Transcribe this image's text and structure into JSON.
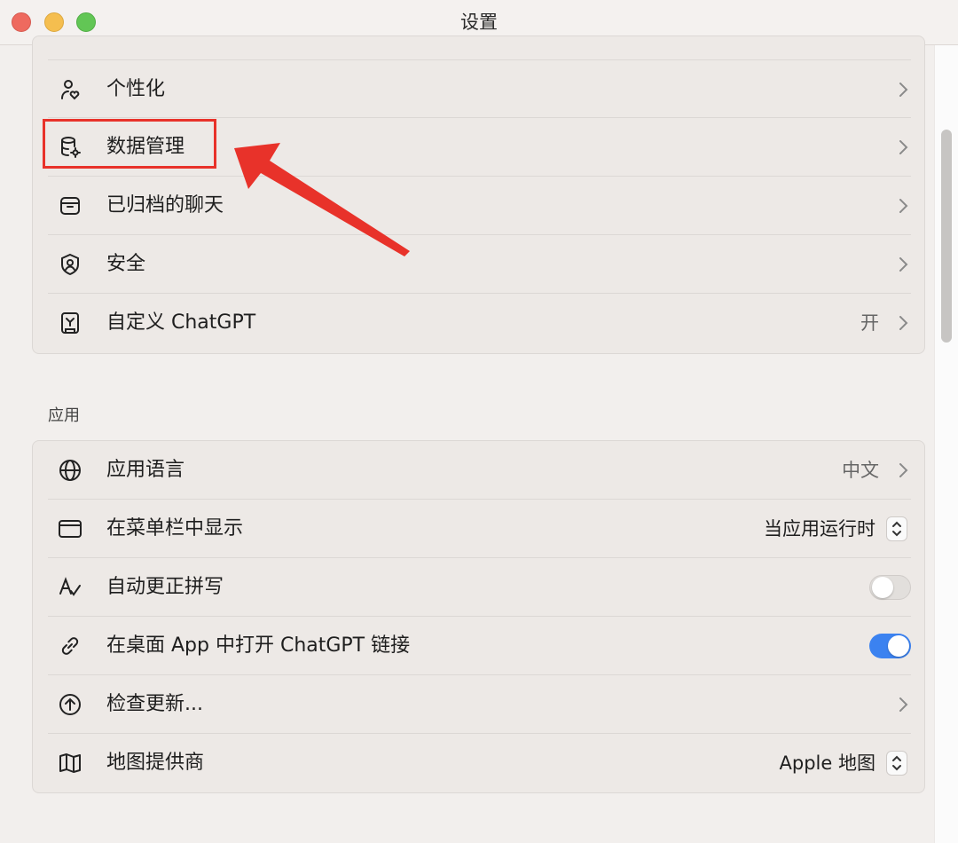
{
  "window": {
    "title": "设置"
  },
  "account_group": {
    "items": [
      {
        "label": "个性化",
        "icon": "person-heart-icon",
        "value": ""
      },
      {
        "label": "数据管理",
        "icon": "database-gear-icon",
        "value": ""
      },
      {
        "label": "已归档的聊天",
        "icon": "archive-icon",
        "value": ""
      },
      {
        "label": "安全",
        "icon": "shield-icon",
        "value": ""
      },
      {
        "label": "自定义 ChatGPT",
        "icon": "custom-gpt-icon",
        "value": "开"
      }
    ]
  },
  "app_section": {
    "header": "应用",
    "items": [
      {
        "label": "应用语言",
        "icon": "globe-icon",
        "value": "中文",
        "control": "chevron"
      },
      {
        "label": "在菜单栏中显示",
        "icon": "window-icon",
        "value": "当应用运行时",
        "control": "popup"
      },
      {
        "label": "自动更正拼写",
        "icon": "spellcheck-icon",
        "control": "toggle",
        "on": false
      },
      {
        "label": "在桌面 App 中打开 ChatGPT 链接",
        "icon": "link-icon",
        "control": "toggle",
        "on": true
      },
      {
        "label": "检查更新...",
        "icon": "upload-circle-icon",
        "value": "",
        "control": "chevron"
      },
      {
        "label": "地图提供商",
        "icon": "map-icon",
        "value": "Apple 地图",
        "control": "popup"
      }
    ]
  },
  "colors": {
    "accent": "#3b82f0",
    "annotation": "#e8322a",
    "background": "#f2efed"
  }
}
